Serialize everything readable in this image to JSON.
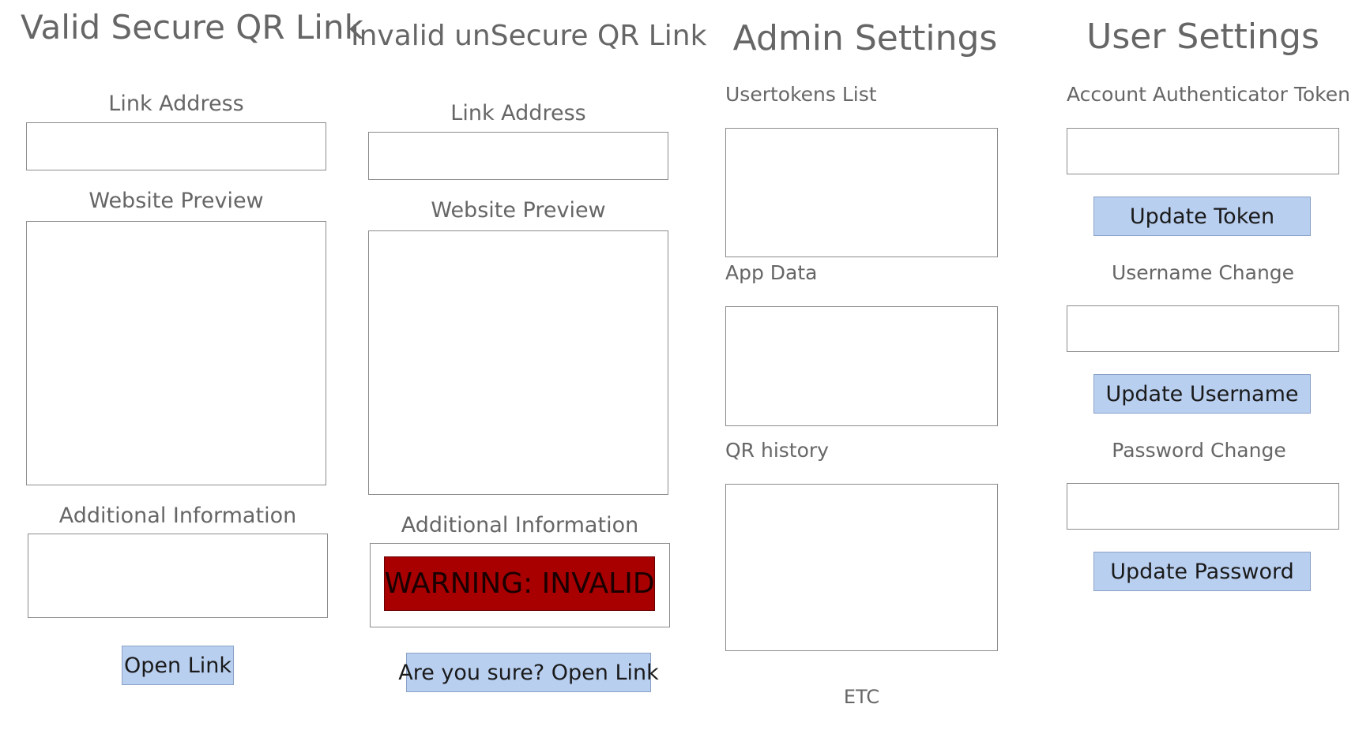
{
  "valid": {
    "title": "Valid Secure QR Link",
    "link_label": "Link Address",
    "link_value": "",
    "preview_label": "Website Preview",
    "info_label": "Additional Information",
    "open_button": "Open Link"
  },
  "invalid": {
    "title": "Invalid unSecure QR Link",
    "link_label": "Link Address",
    "link_value": "",
    "preview_label": "Website Preview",
    "info_label": "Additional Information",
    "warning_text": "WARNING: INVALID",
    "warning_color": "#a80000",
    "open_button": "Are you sure? Open Link"
  },
  "admin": {
    "title": "Admin Settings",
    "usertokens_label": "Usertokens List",
    "app_data_label": "App Data",
    "qr_history_label": "QR history",
    "etc_label": "ETC"
  },
  "user": {
    "title": "User Settings",
    "token_label": "Account Authenticator Token",
    "token_value": "",
    "update_token_button": "Update Token",
    "username_label": "Username Change",
    "username_value": "",
    "update_username_button": "Update Username",
    "password_label": "Password Change",
    "password_value": "",
    "update_password_button": "Update Password"
  },
  "colors": {
    "button_fill": "#b9cff0",
    "button_border": "#8aa2c6",
    "text_gray": "#666666",
    "box_border": "#8c8c8c"
  }
}
